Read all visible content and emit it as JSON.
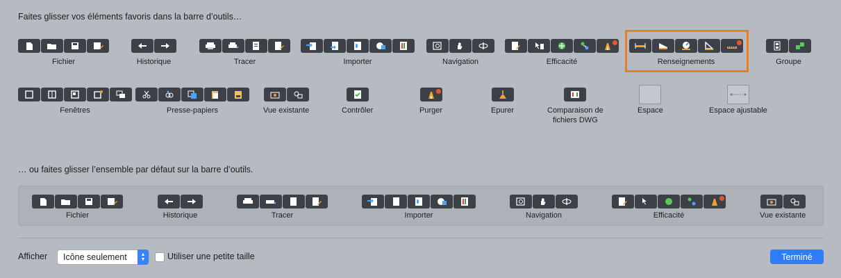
{
  "heading_top": "Faites glisser vos éléments favoris dans la barre d’outils…",
  "heading_default": "… ou faites glisser l’ensemble par défaut sur la barre d’outils.",
  "row1": [
    {
      "label": "Fichier",
      "icons": [
        "new-file-icon",
        "open-folder-icon",
        "save-icon",
        "save-as-icon"
      ]
    },
    {
      "label": "Historique",
      "icons": [
        "undo-icon",
        "redo-icon"
      ]
    },
    {
      "label": "Tracer",
      "icons": [
        "plot-icon",
        "batch-plot-icon",
        "page-setup-icon",
        "publish-icon"
      ]
    },
    {
      "label": "Importer",
      "icons": [
        "import-icon",
        "attach-icon",
        "xref-icon",
        "image-icon",
        "pdf-icon"
      ]
    },
    {
      "label": "Navigation",
      "icons": [
        "zoom-window-icon",
        "pan-hand-icon",
        "orbit-icon"
      ]
    },
    {
      "label": "Efficacité",
      "icons": [
        "properties-icon",
        "quick-select-icon",
        "layer-icon",
        "match-icon",
        "purge-icon"
      ]
    },
    {
      "label": "Renseignements",
      "icons": [
        "distance-icon",
        "area-icon",
        "radius-icon",
        "angle-icon",
        "measure-icon"
      ]
    },
    {
      "label": "Groupe",
      "icons": [
        "group-icon",
        "ungroup-icon"
      ]
    }
  ],
  "row2": [
    {
      "label": "Fenêtres",
      "icons": [
        "window-1-icon",
        "window-2-icon",
        "window-3-icon",
        "window-4-icon",
        "window-5-icon"
      ]
    },
    {
      "label": "Presse-papiers",
      "icons": [
        "cut-icon",
        "copy-icon",
        "copy-base-icon",
        "paste-icon",
        "paste-special-icon"
      ]
    },
    {
      "label": "Vue existante",
      "icons": [
        "named-view-icon",
        "view-manager-icon"
      ]
    },
    {
      "label": "Contrôler",
      "icons": [
        "check-icon"
      ]
    },
    {
      "label": "Purger",
      "icons": [
        "purge-icon"
      ]
    },
    {
      "label": "Epurer",
      "icons": [
        "broom-icon"
      ]
    },
    {
      "label": "Comparaison de\nfichiers DWG",
      "icons": [
        "compare-icon"
      ]
    },
    {
      "label": "Espace",
      "icons": []
    },
    {
      "label": "Espace ajustable",
      "icons": []
    }
  ],
  "default_set": [
    {
      "label": "Fichier",
      "icons": [
        "new-file-icon",
        "open-folder-icon",
        "save-icon",
        "save-as-icon"
      ]
    },
    {
      "label": "Historique",
      "icons": [
        "undo-icon",
        "redo-icon"
      ]
    },
    {
      "label": "Tracer",
      "icons": [
        "plot-icon",
        "batch-plot-icon",
        "page-setup-icon",
        "publish-icon"
      ]
    },
    {
      "label": "Importer",
      "icons": [
        "import-icon",
        "attach-icon",
        "xref-icon",
        "image-icon",
        "pdf-icon"
      ]
    },
    {
      "label": "Navigation",
      "icons": [
        "zoom-window-icon",
        "pan-hand-icon",
        "orbit-icon"
      ]
    },
    {
      "label": "Efficacité",
      "icons": [
        "properties-icon",
        "quick-select-icon",
        "layer-icon",
        "match-icon",
        "purge-icon"
      ]
    },
    {
      "label": "Vue existante",
      "icons": [
        "named-view-icon",
        "view-manager-icon"
      ]
    }
  ],
  "footer": {
    "show_label": "Afficher",
    "show_value": "Icône seulement",
    "small_size_label": "Utiliser une petite taille",
    "done_label": "Terminé"
  },
  "colors": {
    "accent": "#2f7df6",
    "highlight": "#e67e22",
    "button": "#3d4047",
    "alert_dot": "#e4572e"
  }
}
